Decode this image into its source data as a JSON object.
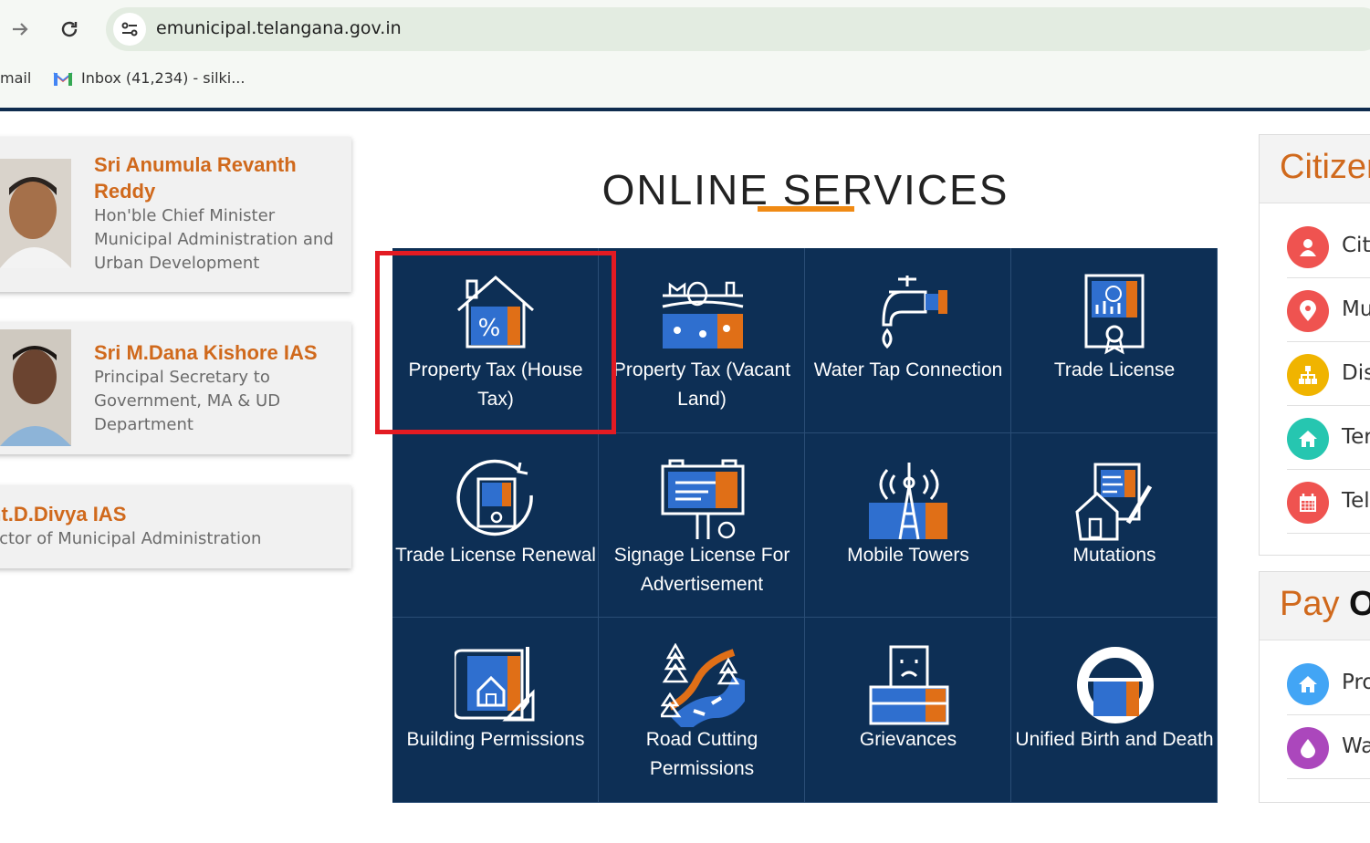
{
  "browser": {
    "url": "emunicipal.telangana.gov.in",
    "bookmarks": [
      {
        "label": "mail"
      },
      {
        "label": "Inbox (41,234) - silki..."
      }
    ]
  },
  "officials": [
    {
      "name": "Sri Anumula Revanth Reddy",
      "role": "Hon'ble Chief Minister Municipal Administration and Urban Development"
    },
    {
      "name": "Sri M.Dana Kishore IAS",
      "role": "Principal Secretary to Government, MA & UD Department"
    },
    {
      "name": "nt.D.Divya IAS",
      "role": "ector of Municipal Administration"
    }
  ],
  "online_services": {
    "title": "ONLINE SERVICES",
    "items": [
      {
        "label": "Property Tax (House Tax)",
        "icon": "house-percent-icon",
        "highlighted": true
      },
      {
        "label": "Property Tax (Vacant Land)",
        "icon": "vacant-land-icon"
      },
      {
        "label": "Water Tap Connection",
        "icon": "water-tap-icon"
      },
      {
        "label": "Trade License",
        "icon": "certificate-icon"
      },
      {
        "label": "Trade License Renewal",
        "icon": "certificate-renew-icon"
      },
      {
        "label": "Signage License For Advertisement",
        "icon": "billboard-icon"
      },
      {
        "label": "Mobile Towers",
        "icon": "tower-icon"
      },
      {
        "label": "Mutations",
        "icon": "house-document-icon"
      },
      {
        "label": "Building Permissions",
        "icon": "blueprint-icon"
      },
      {
        "label": "Road Cutting Permissions",
        "icon": "road-icon"
      },
      {
        "label": "Grievances",
        "icon": "grievance-icon"
      },
      {
        "label": "Unified Birth and Death",
        "icon": "birth-death-icon"
      }
    ]
  },
  "citizen_panel": {
    "title": "Citizen",
    "items": [
      {
        "label": "Cit",
        "icon": "user-icon",
        "color": "#ef5350"
      },
      {
        "label": "Mu",
        "icon": "location-pin-icon",
        "color": "#ef5350"
      },
      {
        "label": "Dis",
        "icon": "sitemap-icon",
        "color": "#f0b400"
      },
      {
        "label": "Ter",
        "icon": "home-icon",
        "color": "#26c6b0"
      },
      {
        "label": "Tel",
        "icon": "calendar-icon",
        "color": "#ef5350"
      }
    ]
  },
  "pay_panel": {
    "title_a": "Pay",
    "title_b": "O",
    "items": [
      {
        "label": "Pro",
        "icon": "home-icon",
        "color": "#42a5f5"
      },
      {
        "label": "Wa",
        "icon": "water-drop-icon",
        "color": "#ab47bc"
      }
    ]
  },
  "colors": {
    "accent_orange": "#d0691c",
    "navy": "#0d2f55",
    "highlight_red": "#e31b23"
  }
}
